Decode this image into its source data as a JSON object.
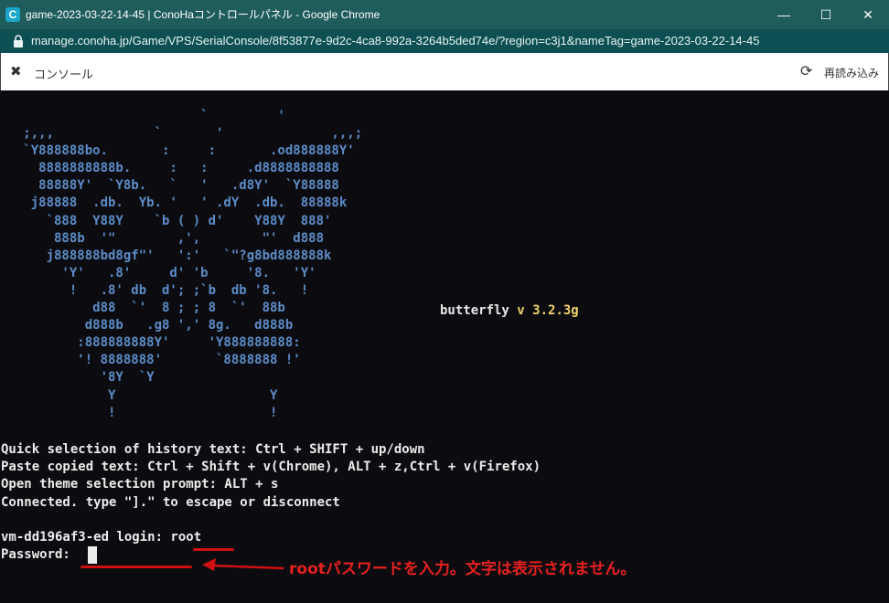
{
  "window": {
    "app_icon_letter": "C",
    "title": "game-2023-03-22-14-45 | ConoHaコントロールパネル - Google Chrome",
    "minimize": "—",
    "maximize": "☐",
    "close": "✕"
  },
  "address": {
    "url": "manage.conoha.jp/Game/VPS/SerialConsole/8f53877e-9d2c-4ca8-992a-3264b5ded74e/?region=c3j1&nameTag=game-2023-03-22-14-45"
  },
  "toolbar": {
    "tools_icon": "✖",
    "console_label": "コンソール",
    "reload_icon": "⟳",
    "reload_label": "再読み込み"
  },
  "terminal": {
    "ascii_art": "                          `         '\n   ;,,,             `       '              ,,,;\n   `Y888888bo.       :     :       .od888888Y'\n     8888888888b.     :   :     .d8888888888\n     88888Y'  `Y8b.   `   '   .d8Y'  `Y88888\n    j88888  .db.  Yb. '   ' .dY  .db.  88888k\n      `888  Y88Y    `b ( ) d'    Y88Y  888'\n       888b  '\"        ,',        \"'  d888\n      j888888bd8gf\"'   ':'   `\"?g8bd888888k\n        'Y'   .8'     d' 'b     '8.   'Y'\n         !   .8' db  d'; ;`b  db '8.   !\n            d88  `'  8 ; ; 8  `'  88b\n           d888b   .g8 ',' 8g.   d888b\n          :888888888Y'     'Y888888888:\n          '! 8888888'       `8888888 !'\n             '8Y  `Y\n              Y                    Y\n              !                    !",
    "brand_name": "butterfly",
    "brand_version": "v 3.2.3g",
    "help_lines": [
      "Quick selection of history text: Ctrl + SHIFT + up/down",
      "Paste copied text: Ctrl + Shift + v(Chrome), ALT + z,Ctrl + v(Firefox)",
      "Open theme selection prompt: ALT + s",
      "Connected. type \"].\" to escape or disconnect"
    ],
    "login_prompt": "vm-dd196af3-ed login: root",
    "password_prompt": "Password: "
  },
  "annotation": {
    "text": "rootパスワードを入力。文字は表示されません。",
    "color": "#e82020"
  },
  "colors": {
    "titlebar": "#1f5c5c",
    "addressbar": "#0d4f52",
    "terminal_bg": "#0c0c10",
    "art": "#5c8cc8",
    "version": "#f0d36b"
  }
}
